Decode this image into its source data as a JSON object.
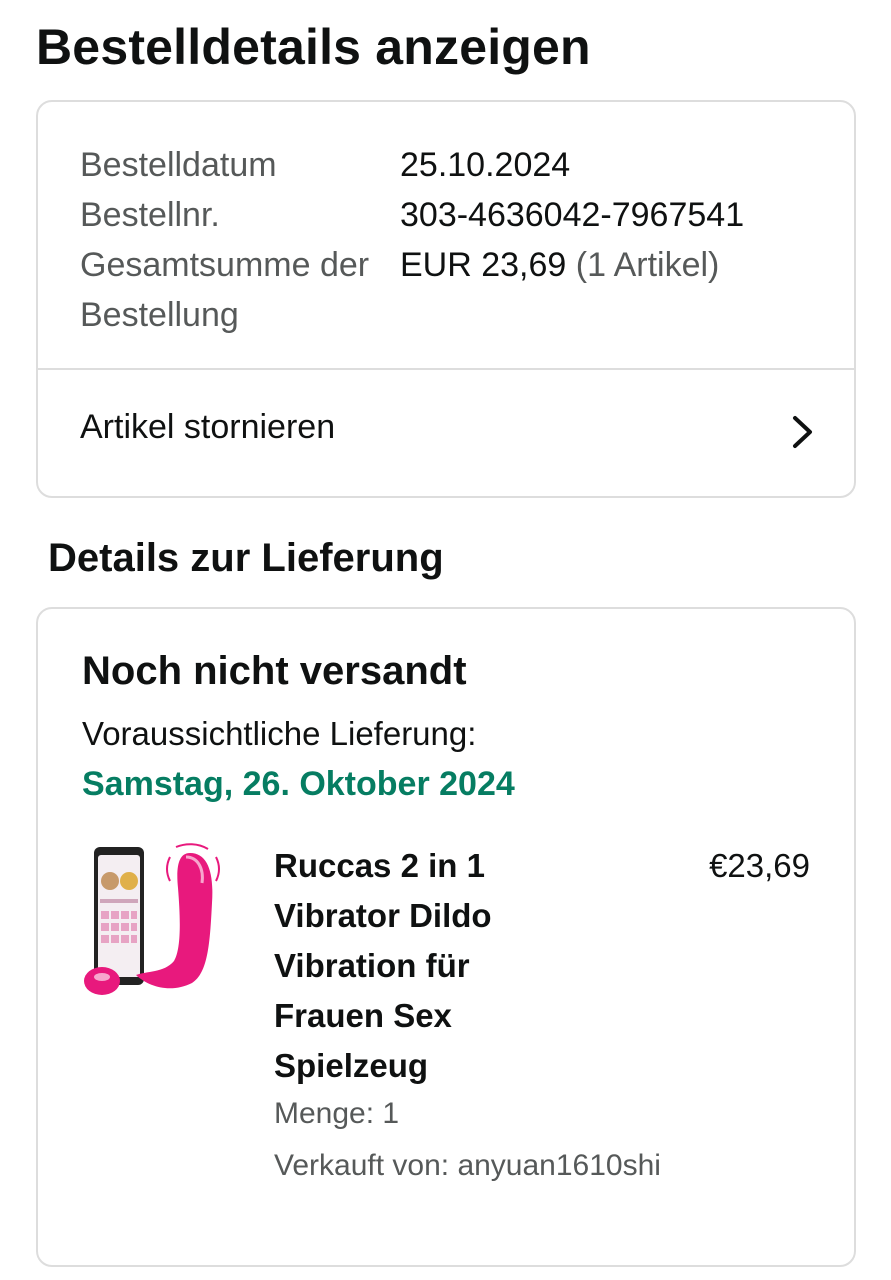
{
  "header": {
    "title": "Bestelldetails anzeigen"
  },
  "summary": {
    "rows": [
      {
        "label": "Bestelldatum",
        "value": "25.10.2024"
      },
      {
        "label": "Bestellnr.",
        "value": "303-4636042-7967541"
      },
      {
        "label": "Gesamtsumme der Bestellung",
        "value": "EUR 23,69",
        "value_note": "(1 Artikel)"
      }
    ],
    "cancel_label": "Artikel stornieren"
  },
  "delivery": {
    "section_title": "Details zur Lieferung",
    "status": "Noch nicht versandt",
    "estimate_label": "Voraussichtliche Lieferung:",
    "estimate_date": "Samstag, 26. Oktober 2024",
    "estimate_color": "#067d62",
    "item": {
      "title": "Ruccas 2 in 1 Vibrator Dildo Vibration für Frauen Sex Spielzeug",
      "price": "€23,69",
      "quantity": "Menge: 1",
      "seller": "Verkauft von: anyuan1610shi",
      "image_icon": "product-image"
    }
  },
  "colors": {
    "text_primary": "#0f1111",
    "text_secondary": "#565959",
    "border": "#dddddd",
    "product_pink": "#e8197d"
  }
}
